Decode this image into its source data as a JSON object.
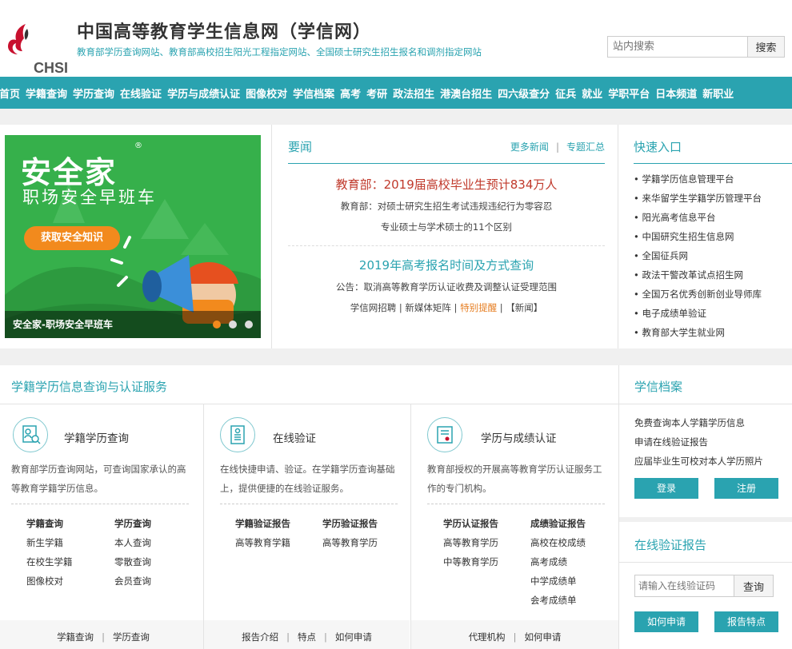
{
  "header": {
    "logo_text": "CHSI",
    "title": "中国高等教育学生信息网（学信网）",
    "subtitle": "教育部学历查询网站、教育部高校招生阳光工程指定网站、全国硕士研究生招生报名和调剂指定网站",
    "search_placeholder": "站内搜索",
    "search_button": "搜索"
  },
  "nav": [
    "首页",
    "学籍查询",
    "学历查询",
    "在线验证",
    "学历与成绩认证",
    "图像校对",
    "学信档案",
    "高考",
    "考研",
    "政法招生",
    "港澳台招生",
    "四六级查分",
    "征兵",
    "就业",
    "学职平台",
    "日本频道",
    "新职业"
  ],
  "banner": {
    "title": "安全家",
    "reg": "®",
    "subtitle": "职场安全早班车",
    "pill": "获取安全知识",
    "caption": "安全家-职场安全早班车"
  },
  "news": {
    "title": "要闻",
    "more": "更多新闻",
    "topics": "专题汇总",
    "headline1": "教育部：2019届高校毕业生预计834万人",
    "line1": "教育部：对硕士研究生招生考试违规违纪行为零容忍",
    "line2": "专业硕士与学术硕士的11个区别",
    "headline2": "2019年高考报名时间及方式查询",
    "line3": "公告：取消高等教育学历认证收费及调整认证受理范围",
    "bottom": {
      "a": "学信网招聘",
      "b": "新媒体矩阵",
      "c": "特别提醒",
      "d": "【新闻】"
    }
  },
  "quick": {
    "title": "快速入口",
    "items": [
      "学籍学历信息管理平台",
      "来华留学生学籍学历管理平台",
      "阳光高考信息平台",
      "中国研究生招生信息网",
      "全国征兵网",
      "政法干警改革试点招生网",
      "全国万名优秀创新创业导师库",
      "电子成绩单验证",
      "教育部大学生就业网"
    ]
  },
  "services": {
    "title": "学籍学历信息查询与认证服务",
    "cols": [
      {
        "name": "学籍学历查询",
        "desc": "教育部学历查询网站，可查询国家承认的高等教育学籍学历信息。",
        "c1": [
          "学籍查询",
          "新生学籍",
          "在校生学籍",
          "图像校对"
        ],
        "c2": [
          "学历查询",
          "本人查询",
          "零散查询",
          "会员查询"
        ],
        "foot": [
          "学籍查询",
          "学历查询"
        ]
      },
      {
        "name": "在线验证",
        "desc": "在线快捷申请、验证。在学籍学历查询基础上，提供便捷的在线验证服务。",
        "c1": [
          "学籍验证报告",
          "高等教育学籍"
        ],
        "c2": [
          "学历验证报告",
          "高等教育学历"
        ],
        "foot": [
          "报告介绍",
          "特点",
          "如何申请"
        ]
      },
      {
        "name": "学历与成绩认证",
        "desc": "教育部授权的开展高等教育学历认证服务工作的专门机构。",
        "c1": [
          "学历认证报告",
          "高等教育学历",
          "中等教育学历"
        ],
        "c2": [
          "成绩验证报告",
          "高校在校成绩",
          "高考成绩",
          "中学成绩单",
          "会考成绩单"
        ],
        "foot": [
          "代理机构",
          "如何申请"
        ]
      }
    ]
  },
  "archive": {
    "title": "学信档案",
    "items": [
      "免费查询本人学籍学历信息",
      "申请在线验证报告",
      "应届毕业生可校对本人学历照片"
    ],
    "login": "登录",
    "register": "注册"
  },
  "verify": {
    "title": "在线验证报告",
    "placeholder": "请输入在线验证码",
    "query": "查询",
    "how": "如何申请",
    "features": "报告特点"
  },
  "colors": {
    "brand": "#2aa3b0",
    "headline": "#c0392b",
    "banner_green": "#36b04b",
    "pill_orange": "#f28a1d"
  }
}
